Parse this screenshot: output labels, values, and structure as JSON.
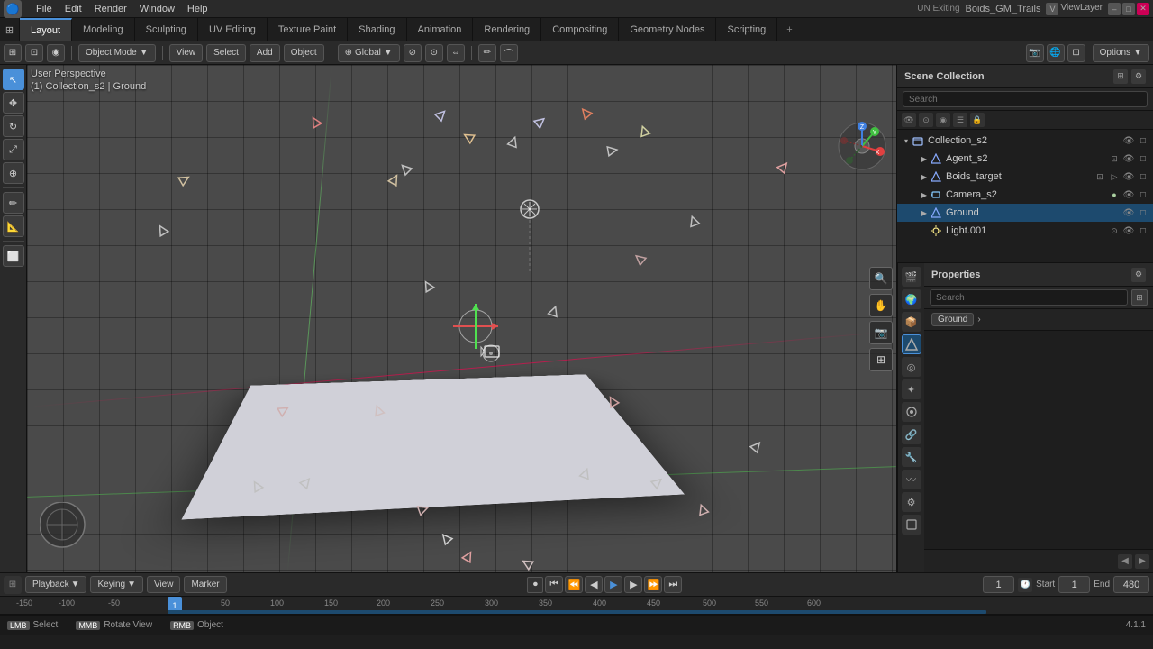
{
  "app": {
    "title": "Boids_GM_Trails",
    "version": "4.1.1",
    "exiting_text": "UN Exiting"
  },
  "menubar": {
    "items": [
      "File",
      "Edit",
      "Render",
      "Window",
      "Help"
    ]
  },
  "workspace_tabs": [
    {
      "label": "Layout",
      "active": true
    },
    {
      "label": "Modeling"
    },
    {
      "label": "Sculpting"
    },
    {
      "label": "UV Editing"
    },
    {
      "label": "Texture Paint"
    },
    {
      "label": "Shading"
    },
    {
      "label": "Animation"
    },
    {
      "label": "Rendering"
    },
    {
      "label": "Compositing"
    },
    {
      "label": "Geometry Nodes"
    },
    {
      "label": "Scripting"
    }
  ],
  "toolbar": {
    "object_mode": "Object Mode",
    "view": "View",
    "select": "Select",
    "add": "Add",
    "object": "Object",
    "transform": "Global",
    "options": "Options"
  },
  "viewport": {
    "perspective_label": "User Perspective",
    "collection_label": "(1) Collection_s2 | Ground"
  },
  "outliner": {
    "title": "Scene Collection",
    "search_placeholder": "Search",
    "collection": "Collection_s2",
    "items": [
      {
        "name": "Agent_s2",
        "icon": "mesh",
        "indent": 2,
        "expanded": false
      },
      {
        "name": "Boids_target",
        "icon": "mesh",
        "indent": 2,
        "expanded": false
      },
      {
        "name": "Camera_s2",
        "icon": "camera",
        "indent": 2,
        "expanded": false
      },
      {
        "name": "Ground",
        "icon": "mesh",
        "indent": 2,
        "expanded": false,
        "selected": true
      },
      {
        "name": "Light.001",
        "icon": "sun",
        "indent": 2,
        "expanded": false
      }
    ]
  },
  "properties": {
    "search_placeholder": "Search",
    "breadcrumb": "Ground",
    "icons": [
      "scene",
      "world",
      "object",
      "mesh",
      "material",
      "particles",
      "physics",
      "constraints",
      "modifiers",
      "shading",
      "render"
    ],
    "strip_icons": [
      "🎬",
      "🌍",
      "📦",
      "△",
      "◎",
      "✦",
      "🔗",
      "🔧",
      "〰",
      "🎨",
      "⚙"
    ]
  },
  "timeline": {
    "playback": "Playback",
    "keying": "Keying",
    "view": "View",
    "marker": "Marker",
    "current_frame": "1",
    "start_frame": "1",
    "end_frame": "480",
    "start_label": "Start",
    "end_label": "End",
    "ruler_marks": [
      "-150",
      "-100",
      "-50",
      "1",
      "50",
      "100",
      "150",
      "200",
      "250",
      "300",
      "350",
      "400",
      "450",
      "500",
      "550",
      "600"
    ]
  },
  "status_bar": {
    "select_key": "Select",
    "rotate_key": "Rotate View",
    "object_key": "Object",
    "version": "4.1.1"
  },
  "colors": {
    "accent": "#4a90d9",
    "selected": "#1d4a6e",
    "bg_dark": "#1a1a1a",
    "bg_medium": "#2a2a2a",
    "bg_panel": "#1e1e1e"
  }
}
